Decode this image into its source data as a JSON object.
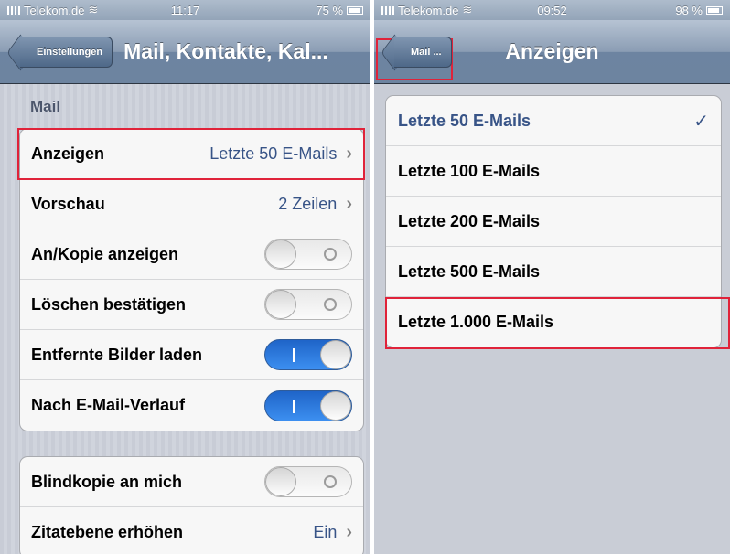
{
  "left": {
    "status": {
      "carrier": "Telekom.de",
      "time": "11:17",
      "battery": "75 %"
    },
    "nav": {
      "back_label": "Einstellungen",
      "title": "Mail, Kontakte, Kal..."
    },
    "section_title": "Mail",
    "group1": [
      {
        "label": "Anzeigen",
        "value": "Letzte 50 E-Mails",
        "type": "link"
      },
      {
        "label": "Vorschau",
        "value": "2 Zeilen",
        "type": "link"
      },
      {
        "label": "An/Kopie anzeigen",
        "type": "toggle",
        "on": false
      },
      {
        "label": "Löschen bestätigen",
        "type": "toggle",
        "on": false
      },
      {
        "label": "Entfernte Bilder laden",
        "type": "toggle",
        "on": true
      },
      {
        "label": "Nach E-Mail-Verlauf",
        "type": "toggle",
        "on": true
      }
    ],
    "group2": [
      {
        "label": "Blindkopie an mich",
        "type": "toggle",
        "on": false
      },
      {
        "label": "Zitatebene erhöhen",
        "value": "Ein",
        "type": "link"
      }
    ]
  },
  "right": {
    "status": {
      "carrier": "Telekom.de",
      "time": "09:52",
      "battery": "98 %"
    },
    "nav": {
      "back_label": "Mail ...",
      "title": "Anzeigen"
    },
    "options": [
      {
        "label": "Letzte 50 E-Mails",
        "selected": true
      },
      {
        "label": "Letzte 100 E-Mails",
        "selected": false
      },
      {
        "label": "Letzte 200 E-Mails",
        "selected": false
      },
      {
        "label": "Letzte 500 E-Mails",
        "selected": false
      },
      {
        "label": "Letzte 1.000 E-Mails",
        "selected": false
      }
    ]
  },
  "colors": {
    "highlight": "#e0233a",
    "toggle_on": "#2f7ae0",
    "value_text": "#385487"
  }
}
